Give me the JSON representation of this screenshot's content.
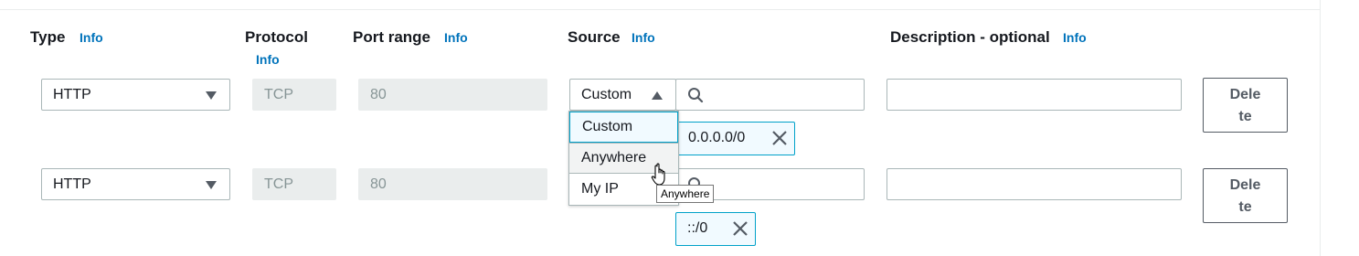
{
  "headers": {
    "type": "Type",
    "protocol": "Protocol",
    "port_range": "Port range",
    "source": "Source",
    "description": "Description - optional",
    "info": "Info"
  },
  "rules": [
    {
      "type": "HTTP",
      "protocol": "TCP",
      "port_range": "80",
      "source_select": "Custom",
      "cidr": "0.0.0.0/0",
      "description": "",
      "delete_label_1": "Dele",
      "delete_label_2": "te"
    },
    {
      "type": "HTTP",
      "protocol": "TCP",
      "port_range": "80",
      "cidr": "::/0",
      "description": "",
      "delete_label_1": "Dele",
      "delete_label_2": "te"
    }
  ],
  "source_dropdown": {
    "options": [
      "Custom",
      "Anywhere",
      "My IP"
    ],
    "selected": "Custom",
    "hovered": "Anywhere"
  },
  "tooltip": "Anywhere",
  "colors": {
    "info_link": "#0073bb",
    "selected_border": "#00a1c9",
    "token_bg": "#f1faff",
    "readonly_bg": "#eaeded"
  },
  "icons": {
    "select_caret": "caret-down-icon",
    "open_caret": "caret-up-icon",
    "search": "search-icon",
    "remove_token": "close-icon",
    "cursor": "hand-pointer-icon"
  }
}
